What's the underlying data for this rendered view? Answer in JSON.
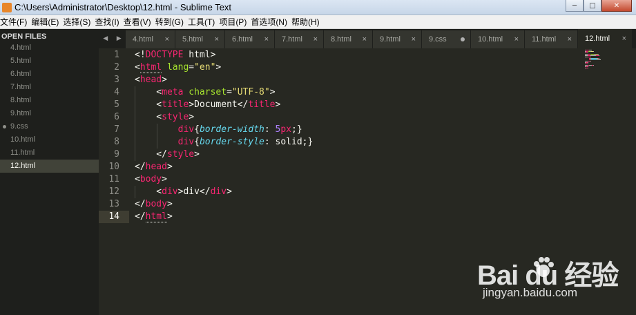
{
  "window": {
    "title": "C:\\Users\\Administrator\\Desktop\\12.html - Sublime Text",
    "minimize": "─",
    "maximize": "□",
    "close": "✕"
  },
  "menu": [
    "文件(F)",
    "编辑(E)",
    "选择(S)",
    "查找(I)",
    "查看(V)",
    "转到(G)",
    "工具(T)",
    "项目(P)",
    "首选项(N)",
    "帮助(H)"
  ],
  "sidebar": {
    "header": "OPEN FILES",
    "files": [
      {
        "name": "4.html",
        "active": false,
        "dirty": false
      },
      {
        "name": "5.html",
        "active": false,
        "dirty": false
      },
      {
        "name": "6.html",
        "active": false,
        "dirty": false
      },
      {
        "name": "7.html",
        "active": false,
        "dirty": false
      },
      {
        "name": "8.html",
        "active": false,
        "dirty": false
      },
      {
        "name": "9.html",
        "active": false,
        "dirty": false
      },
      {
        "name": "9.css",
        "active": false,
        "dirty": true
      },
      {
        "name": "10.html",
        "active": false,
        "dirty": false
      },
      {
        "name": "11.html",
        "active": false,
        "dirty": false
      },
      {
        "name": "12.html",
        "active": true,
        "dirty": false
      }
    ]
  },
  "tabs": {
    "nav_left": "◀",
    "nav_right": "▶",
    "items": [
      {
        "name": "4.html",
        "active": false,
        "dirty": false
      },
      {
        "name": "5.html",
        "active": false,
        "dirty": false
      },
      {
        "name": "6.html",
        "active": false,
        "dirty": false
      },
      {
        "name": "7.html",
        "active": false,
        "dirty": false
      },
      {
        "name": "8.html",
        "active": false,
        "dirty": false
      },
      {
        "name": "9.html",
        "active": false,
        "dirty": false
      },
      {
        "name": "9.css",
        "active": false,
        "dirty": true
      },
      {
        "name": "10.html",
        "active": false,
        "dirty": false
      },
      {
        "name": "11.html",
        "active": false,
        "dirty": false
      },
      {
        "name": "12.html",
        "active": true,
        "dirty": false
      }
    ],
    "close_glyph": "×"
  },
  "editor": {
    "current_line": 14,
    "lines": [
      [
        [
          "t-plain",
          "<!"
        ],
        [
          "t-tag",
          "DOCTYPE"
        ],
        [
          "t-plain",
          " html>"
        ]
      ],
      [
        [
          "t-plain",
          "<"
        ],
        [
          "t-tag t-ul",
          "html"
        ],
        [
          "t-plain",
          " "
        ],
        [
          "t-attr",
          "lang"
        ],
        [
          "t-plain",
          "="
        ],
        [
          "t-str",
          "\"en\""
        ],
        [
          "t-plain",
          ">"
        ]
      ],
      [
        [
          "t-plain",
          "<"
        ],
        [
          "t-tag",
          "head"
        ],
        [
          "t-plain",
          ">"
        ]
      ],
      [
        [
          "t-plain",
          "    <"
        ],
        [
          "t-tag",
          "meta"
        ],
        [
          "t-plain",
          " "
        ],
        [
          "t-attr",
          "charset"
        ],
        [
          "t-plain",
          "="
        ],
        [
          "t-str",
          "\"UTF-8\""
        ],
        [
          "t-plain",
          ">"
        ]
      ],
      [
        [
          "t-plain",
          "    <"
        ],
        [
          "t-tag",
          "title"
        ],
        [
          "t-plain",
          ">Document</"
        ],
        [
          "t-tag",
          "title"
        ],
        [
          "t-plain",
          ">"
        ]
      ],
      [
        [
          "t-plain",
          "    <"
        ],
        [
          "t-tag",
          "style"
        ],
        [
          "t-plain",
          ">"
        ]
      ],
      [
        [
          "t-plain",
          "        "
        ],
        [
          "t-tag",
          "div"
        ],
        [
          "t-plain",
          "{"
        ],
        [
          "t-prop",
          "border-width"
        ],
        [
          "t-plain",
          ": "
        ],
        [
          "t-num",
          "5"
        ],
        [
          "t-tag",
          "px"
        ],
        [
          "t-plain",
          ";}"
        ]
      ],
      [
        [
          "t-plain",
          "        "
        ],
        [
          "t-tag",
          "div"
        ],
        [
          "t-plain",
          "{"
        ],
        [
          "t-prop",
          "border-style"
        ],
        [
          "t-plain",
          ": solid;}"
        ]
      ],
      [
        [
          "t-plain",
          "    </"
        ],
        [
          "t-tag",
          "style"
        ],
        [
          "t-plain",
          ">"
        ]
      ],
      [
        [
          "t-plain",
          "</"
        ],
        [
          "t-tag",
          "head"
        ],
        [
          "t-plain",
          ">"
        ]
      ],
      [
        [
          "t-plain",
          "<"
        ],
        [
          "t-tag",
          "body"
        ],
        [
          "t-plain",
          ">"
        ]
      ],
      [
        [
          "t-plain",
          "    <"
        ],
        [
          "t-tag",
          "div"
        ],
        [
          "t-plain",
          ">div</"
        ],
        [
          "t-tag",
          "div"
        ],
        [
          "t-plain",
          ">"
        ]
      ],
      [
        [
          "t-plain",
          "</"
        ],
        [
          "t-tag",
          "body"
        ],
        [
          "t-plain",
          ">"
        ]
      ],
      [
        [
          "t-plain",
          "</"
        ],
        [
          "t-tag t-ul",
          "html"
        ],
        [
          "t-plain",
          ">"
        ]
      ]
    ]
  },
  "watermark": {
    "logo": "Bai du 经验",
    "url": "jingyan.baidu.com"
  },
  "colors": {
    "editor_bg": "#272822",
    "sidebar_bg": "#1e1f1c",
    "tag": "#f92672",
    "attr": "#a6e22e",
    "string": "#e6db74",
    "property": "#66d9ef",
    "number": "#ae81ff"
  }
}
